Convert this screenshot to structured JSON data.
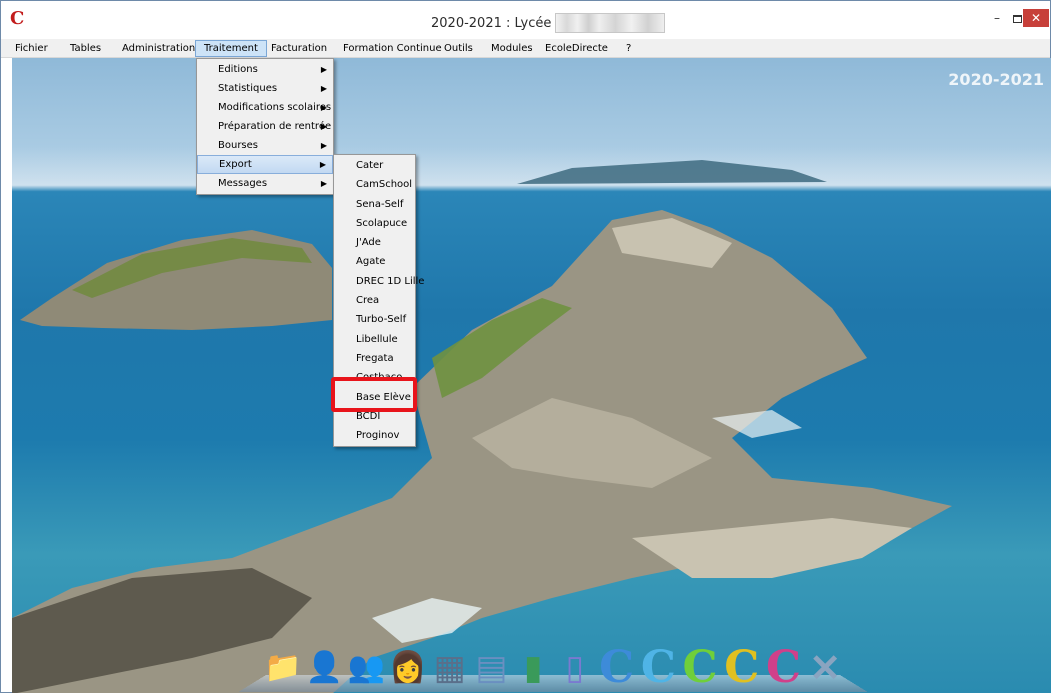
{
  "window": {
    "title": "2020-2021 : Lycée",
    "app_icon_glyph": "C"
  },
  "menubar": {
    "items": [
      {
        "label": "Fichier"
      },
      {
        "label": "Tables"
      },
      {
        "label": "Administration"
      },
      {
        "label": "Traitement",
        "active": true
      },
      {
        "label": "Facturation"
      },
      {
        "label": "Formation Continue"
      },
      {
        "label": "Outils"
      },
      {
        "label": "Modules"
      },
      {
        "label": "EcoleDirecte"
      },
      {
        "label": "?"
      }
    ]
  },
  "desktop": {
    "year_label": "2020-2021"
  },
  "traitement_menu": {
    "items": [
      {
        "label": "Editions",
        "has_submenu": true
      },
      {
        "label": "Statistiques",
        "has_submenu": true
      },
      {
        "label": "Modifications scolaires",
        "has_submenu": true
      },
      {
        "label": "Préparation de rentrée",
        "has_submenu": true
      },
      {
        "label": "Bourses",
        "has_submenu": true
      },
      {
        "label": "Export",
        "has_submenu": true,
        "highlighted": true
      },
      {
        "label": "Messages",
        "has_submenu": true
      }
    ]
  },
  "export_submenu": {
    "items": [
      {
        "label": "Cater"
      },
      {
        "label": "CamSchool"
      },
      {
        "label": "Sena-Self"
      },
      {
        "label": "Scolapuce"
      },
      {
        "label": "J'Ade"
      },
      {
        "label": "Agate"
      },
      {
        "label": "DREC 1D Lille"
      },
      {
        "label": "Crea"
      },
      {
        "label": "Turbo-Self"
      },
      {
        "label": "Libellule"
      },
      {
        "label": "Fregata"
      },
      {
        "label": "Costhaco"
      },
      {
        "label": "Base Elève",
        "annotated": true
      },
      {
        "label": "BCDI"
      },
      {
        "label": "Proginov"
      }
    ]
  },
  "dock": {
    "icons": [
      {
        "name": "folder-icon",
        "glyph": "📁",
        "color": "#4a7fc0"
      },
      {
        "name": "user-icon",
        "glyph": "👤",
        "color": "#6a9a3a"
      },
      {
        "name": "group-icon",
        "glyph": "👥",
        "color": "#a0643a"
      },
      {
        "name": "teacher-icon",
        "glyph": "👩",
        "color": "#8a3a2a"
      },
      {
        "name": "calendar-icon",
        "glyph": "▦",
        "color": "#5a6f8a"
      },
      {
        "name": "document-icon",
        "glyph": "▤",
        "color": "#6a8fc0"
      },
      {
        "name": "chart-icon",
        "glyph": "▮",
        "color": "#3a9a5a"
      },
      {
        "name": "phone-icon",
        "glyph": "▯",
        "color": "#7a7ad0"
      },
      {
        "name": "c-blue-icon",
        "glyph": "C",
        "color": "#3d8bd9"
      },
      {
        "name": "c-lightblue-icon",
        "glyph": "C",
        "color": "#4fb4e6"
      },
      {
        "name": "c-green-icon",
        "glyph": "C",
        "color": "#6fcf3a"
      },
      {
        "name": "c-yellow-icon",
        "glyph": "C",
        "color": "#e0c020"
      },
      {
        "name": "c-multicolor-icon",
        "glyph": "C",
        "color": "#d0408a"
      },
      {
        "name": "close-icon",
        "glyph": "✕",
        "color": "#8aa4c0"
      }
    ]
  },
  "colors": {
    "highlight_box": "#e8141b",
    "menu_bg": "#f0f0f0",
    "menubar_active_bg": "#cde3f7",
    "close_button": "#c7403a"
  }
}
